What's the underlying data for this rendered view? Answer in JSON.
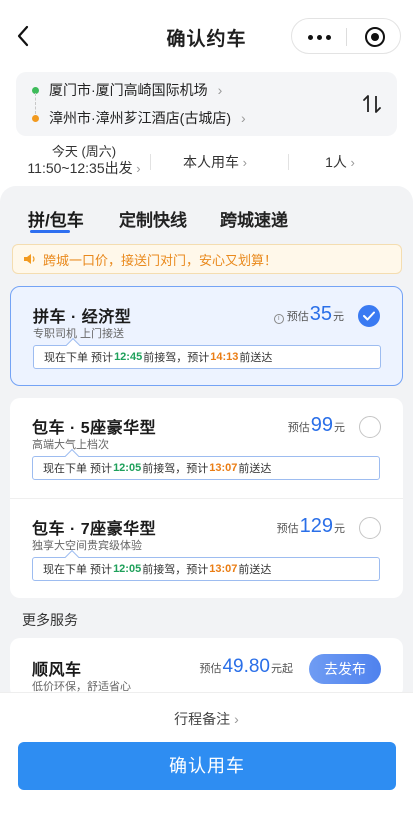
{
  "header": {
    "title": "确认约车"
  },
  "route": {
    "from": "厦门市·厦门高崎国际机场",
    "to": "漳州市·漳州芗江酒店(古城店)",
    "from_color": "#3dbb5a",
    "to_color": "#f29a1f"
  },
  "options": {
    "day": "今天 (周六)",
    "time_range": "11:50~12:35出发",
    "rider": "本人用车",
    "passengers": "1人"
  },
  "tabs": [
    {
      "label": "拼/包车",
      "active": true
    },
    {
      "label": "定制快线",
      "active": false
    },
    {
      "label": "跨城速递",
      "active": false
    }
  ],
  "notice": "跨城一口价，接送门对门，安心又划算！",
  "products": [
    {
      "name": "拼车 · 经济型",
      "desc": "专职司机 上门接送",
      "price_prefix": "预估",
      "price": "35",
      "unit": "元",
      "selected": true,
      "eta": {
        "p1": "现在下单 预计",
        "pickup": "12:45",
        "p2": "前接驾，预计",
        "arrive": "14:13",
        "p3": "前送达"
      }
    },
    {
      "name": "包车 · 5座豪华型",
      "desc": "高端大气上档次",
      "price_prefix": "预估",
      "price": "99",
      "unit": "元",
      "selected": false,
      "eta": {
        "p1": "现在下单 预计",
        "pickup": "12:05",
        "p2": "前接驾，预计",
        "arrive": "13:07",
        "p3": "前送达"
      }
    },
    {
      "name": "包车 · 7座豪华型",
      "desc": "独享大空间贵宾级体验",
      "price_prefix": "预估",
      "price": "129",
      "unit": "元",
      "selected": false,
      "eta": {
        "p1": "现在下单 预计",
        "pickup": "12:05",
        "p2": "前接驾，预计",
        "arrive": "13:07",
        "p3": "前送达"
      }
    }
  ],
  "more_services": {
    "title": "更多服务",
    "hitch": {
      "name": "顺风车",
      "desc": "低价环保，舒适省心",
      "price_prefix": "预估",
      "price": "49.80",
      "unit": "元起",
      "button": "去发布"
    }
  },
  "bottom": {
    "remark": "行程备注",
    "confirm": "确认用车"
  },
  "colors": {
    "accent": "#2e8df2",
    "price": "#2a6fe8",
    "pickup_time": "#1ea05a",
    "arrive_time": "#ea7d14"
  }
}
